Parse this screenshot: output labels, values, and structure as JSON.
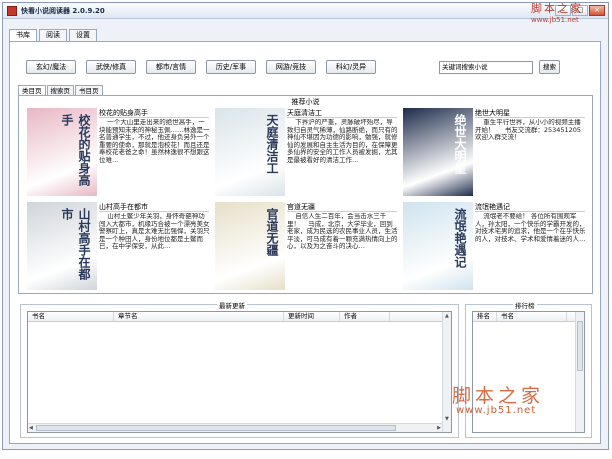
{
  "window": {
    "title": "快看小说阅读器 2.0.9.20"
  },
  "main_tabs": [
    "书库",
    "阅读",
    "设置"
  ],
  "categories": [
    "玄幻/魔法",
    "武侠/修真",
    "都市/言情",
    "历史/军事",
    "网游/竞技",
    "科幻/灵异"
  ],
  "search": {
    "value": "关键词搜索小说",
    "button": "搜索"
  },
  "sub_tabs": [
    "类目页",
    "搜索页",
    "书目页"
  ],
  "recommend": {
    "title": "推荐小说",
    "books": [
      {
        "title": "校花的贴身高手",
        "desc": "    一个大山里走出来的绝世高手，一块能预知未来的神秘玉佩……林逸是一名普通学生，不过，他还身负另外一个重要的使命，那就是泡校花！而且还是奉校花老爸之命！虽然林逸很不想跟这位难…",
        "cover_text": "校花的贴身高手",
        "cover_color": "#e8b7c4"
      },
      {
        "title": "天庭清洁工",
        "desc": "    下界沪的严重，灵脉破坏殆尽，导致归自灵气稀薄，仙路断绝，而只有的神仙不堪因为功德的影响，勉强，就修仙的发展和自主生活为目的，在保障更多仙界的安全的工作人员被发掘，尤其是最被看好的清洁工作…",
        "cover_text": "天庭清洁工",
        "cover_color": "#d9e4ea"
      },
      {
        "title": "绝世大明星",
        "desc": "    重生平行世界，从小小的视频主播开始！     书友交流群：253451205     欢迎入群交流！",
        "cover_text": "绝世大明星",
        "cover_color": "#1d2b4a"
      },
      {
        "title": "山村高手在都市",
        "desc": "    山村土鳖少年关羽，身怀奇葩神功闯入大都市，机缘巧合被一个漂亮美女警察盯上，真是太难无比强悍，关羽只是一个种田人，身份地位都是土鳖而已，在中学保安，从此…",
        "cover_text": "山村高手在都市",
        "cover_color": "#cfd5da"
      },
      {
        "title": "官道无疆",
        "desc": "    自信人生二百年，会当击水三千里！    马成，北京，大学毕业，回到老家，成为民选的农民事业人员，生活平淡，可马成有着一颗充满热情向上的心，以及为之奋斗的决心…",
        "cover_text": "官道无疆",
        "cover_color": "#e6dfc8"
      },
      {
        "title": "流氓艳遇记",
        "desc": "    流氓老不要给！ 各位所有围观军人，孙太阳，一个快乐的学霸开发的，对技术宅男的追求，他是一个在乎快乐的人，对技术、学术和爱情着迷的人…",
        "cover_text": "流氓艳遇记",
        "cover_color": "#cfe3ee"
      }
    ]
  },
  "updates": {
    "title": "最新更新",
    "columns": [
      "书名",
      "章节名",
      "更新时间",
      "作者"
    ]
  },
  "ranking": {
    "title": "排行榜",
    "columns": [
      "排名",
      "书名"
    ]
  },
  "watermark": {
    "text": "脚本之家",
    "url": "www.jb51.net"
  },
  "icons": [
    "app-icon",
    "minimize-icon",
    "maximize-icon",
    "close-icon"
  ]
}
